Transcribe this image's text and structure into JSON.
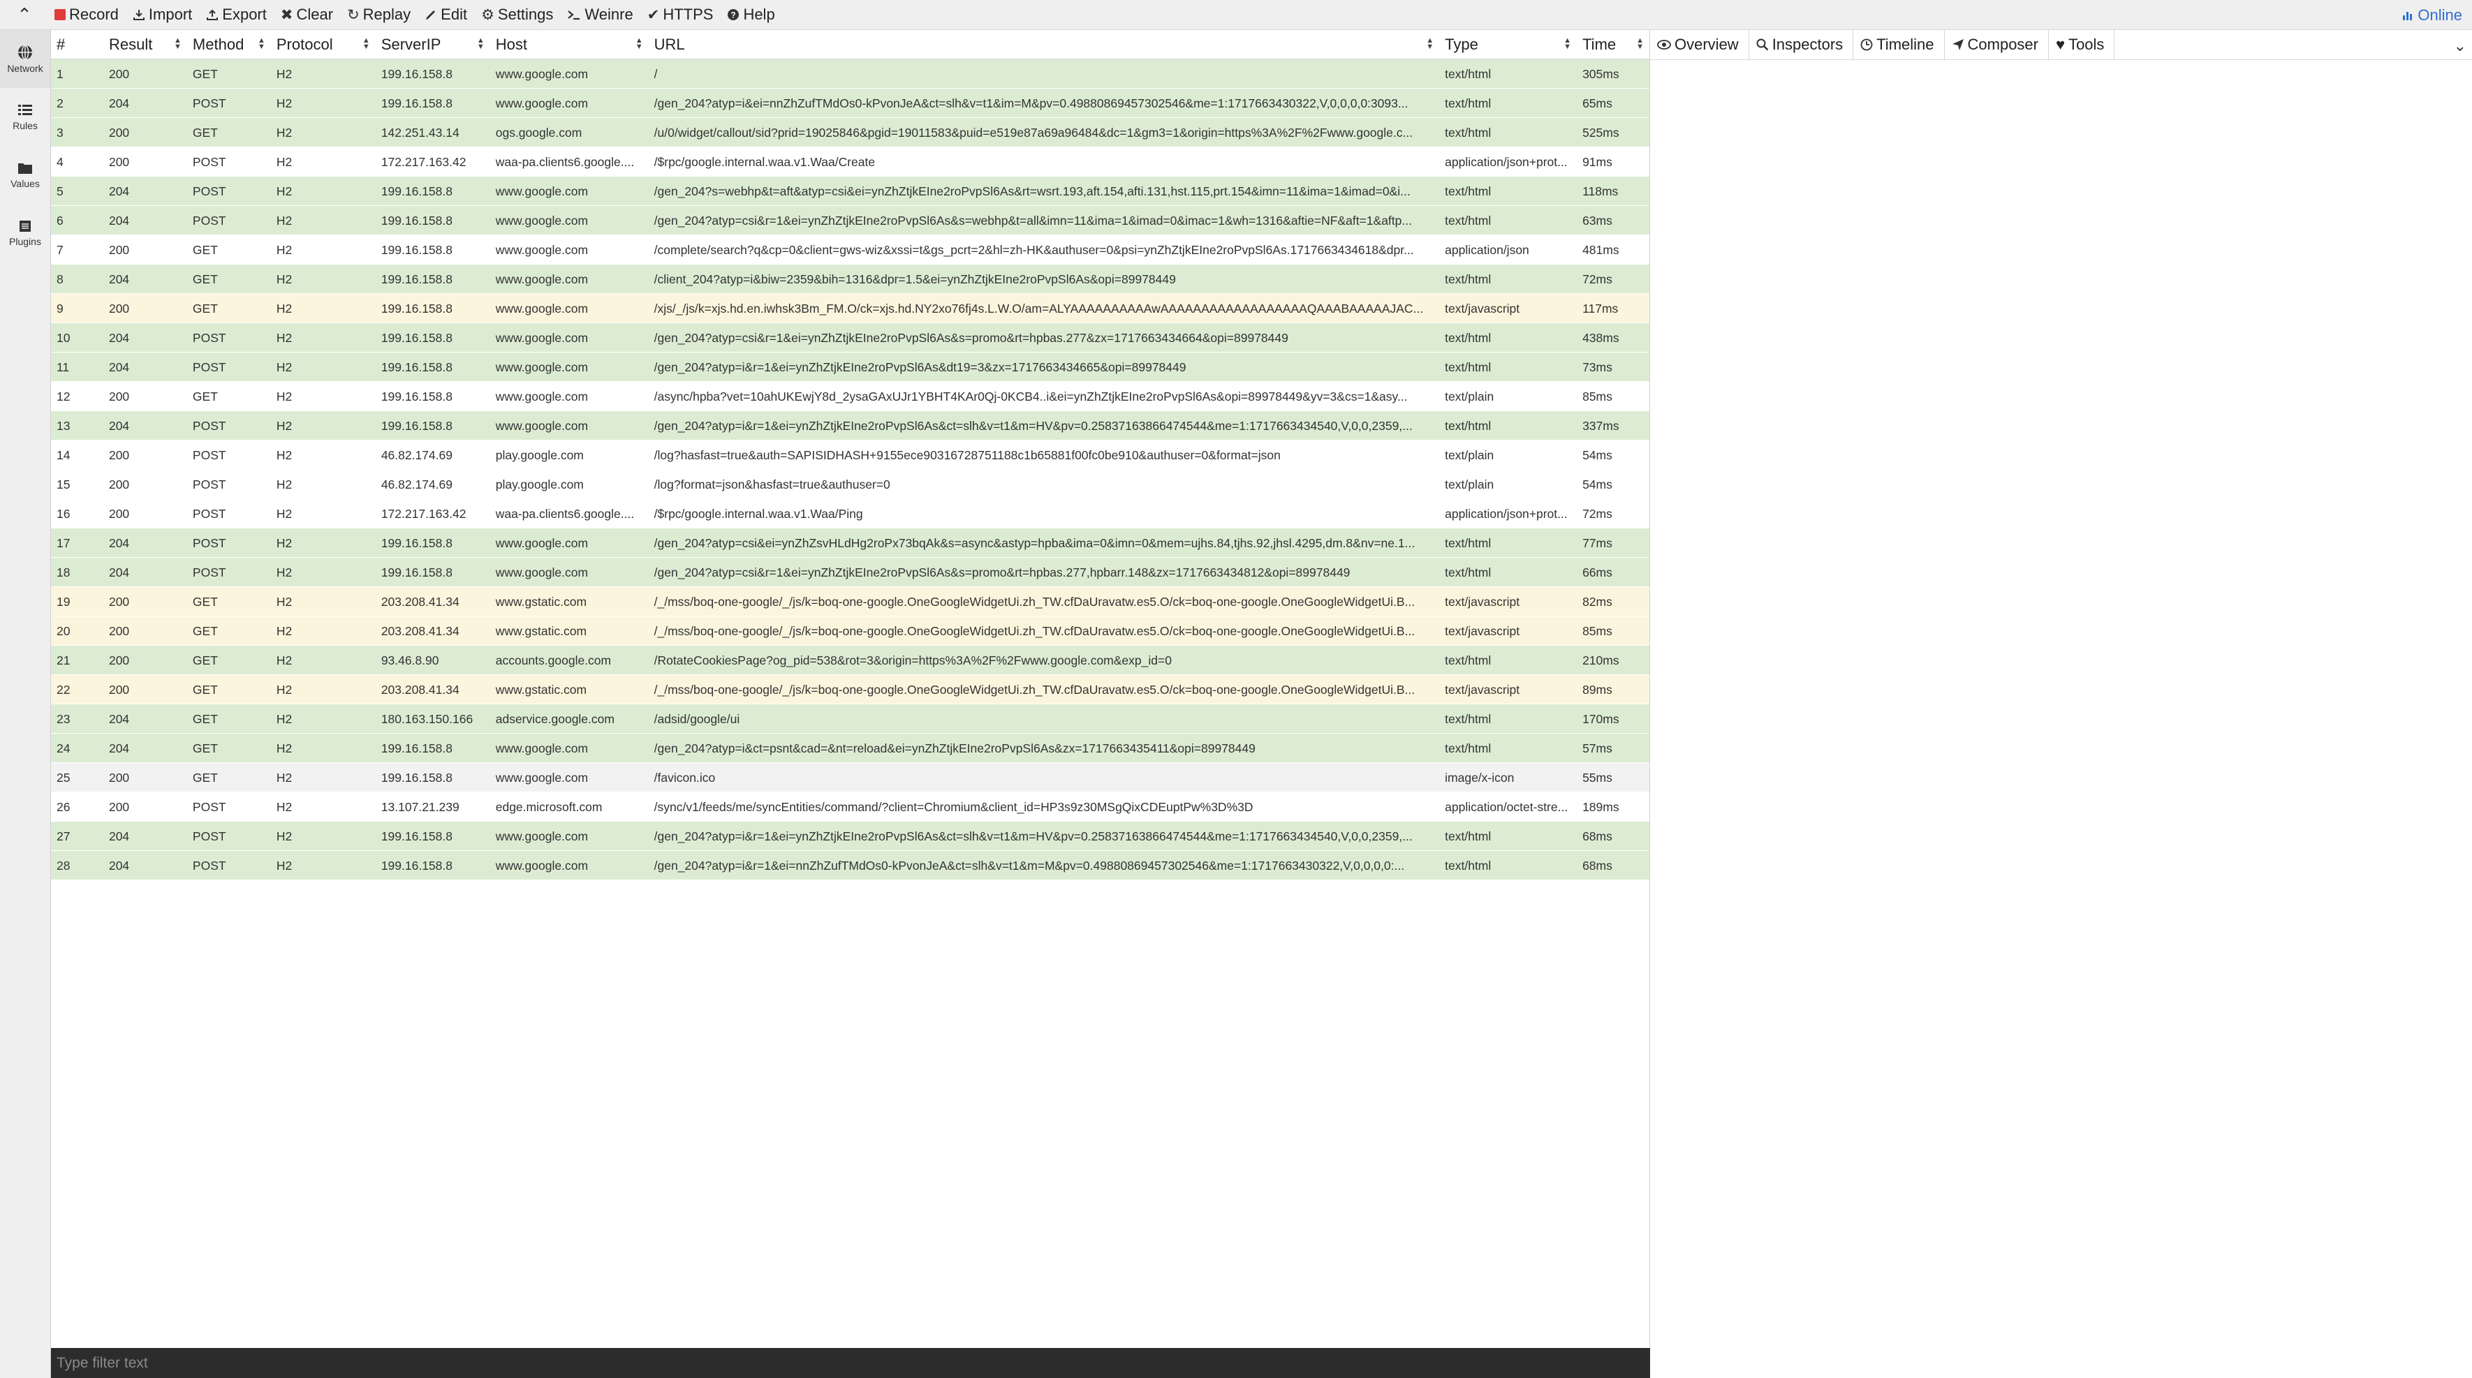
{
  "toolbar": {
    "items": [
      {
        "label": "Record",
        "icon": "record-icon"
      },
      {
        "label": "Import",
        "icon": "import-icon"
      },
      {
        "label": "Export",
        "icon": "export-icon"
      },
      {
        "label": "Clear",
        "icon": "clear-icon"
      },
      {
        "label": "Replay",
        "icon": "replay-icon"
      },
      {
        "label": "Edit",
        "icon": "edit-icon"
      },
      {
        "label": "Settings",
        "icon": "gear-icon"
      },
      {
        "label": "Weinre",
        "icon": "terminal-icon"
      },
      {
        "label": "HTTPS",
        "icon": "check-icon"
      },
      {
        "label": "Help",
        "icon": "help-icon"
      }
    ],
    "status": "Online"
  },
  "sidebar": {
    "items": [
      {
        "label": "Network",
        "icon": "network-icon"
      },
      {
        "label": "Rules",
        "icon": "rules-icon"
      },
      {
        "label": "Values",
        "icon": "folder-icon"
      },
      {
        "label": "Plugins",
        "icon": "plugins-icon"
      }
    ]
  },
  "table": {
    "columns": [
      "#",
      "Result",
      "Method",
      "Protocol",
      "ServerIP",
      "Host",
      "URL",
      "Type",
      "Time"
    ],
    "rows": [
      {
        "n": "1",
        "result": "200",
        "method": "GET",
        "protocol": "H2",
        "ip": "199.16.158.8",
        "host": "www.google.com",
        "url": "/",
        "type": "text/html",
        "time": "305ms",
        "color": "green"
      },
      {
        "n": "2",
        "result": "204",
        "method": "POST",
        "protocol": "H2",
        "ip": "199.16.158.8",
        "host": "www.google.com",
        "url": "/gen_204?atyp=i&ei=nnZhZufTMdOs0-kPvonJeA&ct=slh&v=t1&im=M&pv=0.49880869457302546&me=1:1717663430322,V,0,0,0,0:3093...",
        "type": "text/html",
        "time": "65ms",
        "color": "green"
      },
      {
        "n": "3",
        "result": "200",
        "method": "GET",
        "protocol": "H2",
        "ip": "142.251.43.14",
        "host": "ogs.google.com",
        "url": "/u/0/widget/callout/sid?prid=19025846&pgid=19011583&puid=e519e87a69a96484&dc=1&gm3=1&origin=https%3A%2F%2Fwww.google.c...",
        "type": "text/html",
        "time": "525ms",
        "color": "green"
      },
      {
        "n": "4",
        "result": "200",
        "method": "POST",
        "protocol": "H2",
        "ip": "172.217.163.42",
        "host": "waa-pa.clients6.google....",
        "url": "/$rpc/google.internal.waa.v1.Waa/Create",
        "type": "application/json+prot...",
        "time": "91ms",
        "color": "white"
      },
      {
        "n": "5",
        "result": "204",
        "method": "POST",
        "protocol": "H2",
        "ip": "199.16.158.8",
        "host": "www.google.com",
        "url": "/gen_204?s=webhp&t=aft&atyp=csi&ei=ynZhZtjkEIne2roPvpSl6As&rt=wsrt.193,aft.154,afti.131,hst.115,prt.154&imn=11&ima=1&imad=0&i...",
        "type": "text/html",
        "time": "118ms",
        "color": "green"
      },
      {
        "n": "6",
        "result": "204",
        "method": "POST",
        "protocol": "H2",
        "ip": "199.16.158.8",
        "host": "www.google.com",
        "url": "/gen_204?atyp=csi&r=1&ei=ynZhZtjkEIne2roPvpSl6As&s=webhp&t=all&imn=11&ima=1&imad=0&imac=1&wh=1316&aftie=NF&aft=1&aftp...",
        "type": "text/html",
        "time": "63ms",
        "color": "green"
      },
      {
        "n": "7",
        "result": "200",
        "method": "GET",
        "protocol": "H2",
        "ip": "199.16.158.8",
        "host": "www.google.com",
        "url": "/complete/search?q&cp=0&client=gws-wiz&xssi=t&gs_pcrt=2&hl=zh-HK&authuser=0&psi=ynZhZtjkEIne2roPvpSl6As.1717663434618&dpr...",
        "type": "application/json",
        "time": "481ms",
        "color": "white"
      },
      {
        "n": "8",
        "result": "204",
        "method": "GET",
        "protocol": "H2",
        "ip": "199.16.158.8",
        "host": "www.google.com",
        "url": "/client_204?atyp=i&biw=2359&bih=1316&dpr=1.5&ei=ynZhZtjkEIne2roPvpSl6As&opi=89978449",
        "type": "text/html",
        "time": "72ms",
        "color": "green"
      },
      {
        "n": "9",
        "result": "200",
        "method": "GET",
        "protocol": "H2",
        "ip": "199.16.158.8",
        "host": "www.google.com",
        "url": "/xjs/_/js/k=xjs.hd.en.iwhsk3Bm_FM.O/ck=xjs.hd.NY2xo76fj4s.L.W.O/am=ALYAAAAAAAAAAwAAAAAAAAAAAAAAAAAAQAAABAAAAAJAC...",
        "type": "text/javascript",
        "time": "117ms",
        "color": "yellow"
      },
      {
        "n": "10",
        "result": "204",
        "method": "POST",
        "protocol": "H2",
        "ip": "199.16.158.8",
        "host": "www.google.com",
        "url": "/gen_204?atyp=csi&r=1&ei=ynZhZtjkEIne2roPvpSl6As&s=promo&rt=hpbas.277&zx=1717663434664&opi=89978449",
        "type": "text/html",
        "time": "438ms",
        "color": "green"
      },
      {
        "n": "11",
        "result": "204",
        "method": "POST",
        "protocol": "H2",
        "ip": "199.16.158.8",
        "host": "www.google.com",
        "url": "/gen_204?atyp=i&r=1&ei=ynZhZtjkEIne2roPvpSl6As&dt19=3&zx=1717663434665&opi=89978449",
        "type": "text/html",
        "time": "73ms",
        "color": "green"
      },
      {
        "n": "12",
        "result": "200",
        "method": "GET",
        "protocol": "H2",
        "ip": "199.16.158.8",
        "host": "www.google.com",
        "url": "/async/hpba?vet=10ahUKEwjY8d_2ysaGAxUJr1YBHT4KAr0Qj-0KCB4..i&ei=ynZhZtjkEIne2roPvpSl6As&opi=89978449&yv=3&cs=1&asy...",
        "type": "text/plain",
        "time": "85ms",
        "color": "white"
      },
      {
        "n": "13",
        "result": "204",
        "method": "POST",
        "protocol": "H2",
        "ip": "199.16.158.8",
        "host": "www.google.com",
        "url": "/gen_204?atyp=i&r=1&ei=ynZhZtjkEIne2roPvpSl6As&ct=slh&v=t1&m=HV&pv=0.25837163866474544&me=1:1717663434540,V,0,0,2359,...",
        "type": "text/html",
        "time": "337ms",
        "color": "green"
      },
      {
        "n": "14",
        "result": "200",
        "method": "POST",
        "protocol": "H2",
        "ip": "46.82.174.69",
        "host": "play.google.com",
        "url": "/log?hasfast=true&auth=SAPISIDHASH+9155ece90316728751188c1b65881f00fc0be910&authuser=0&format=json",
        "type": "text/plain",
        "time": "54ms",
        "color": "white"
      },
      {
        "n": "15",
        "result": "200",
        "method": "POST",
        "protocol": "H2",
        "ip": "46.82.174.69",
        "host": "play.google.com",
        "url": "/log?format=json&hasfast=true&authuser=0",
        "type": "text/plain",
        "time": "54ms",
        "color": "white"
      },
      {
        "n": "16",
        "result": "200",
        "method": "POST",
        "protocol": "H2",
        "ip": "172.217.163.42",
        "host": "waa-pa.clients6.google....",
        "url": "/$rpc/google.internal.waa.v1.Waa/Ping",
        "type": "application/json+prot...",
        "time": "72ms",
        "color": "white"
      },
      {
        "n": "17",
        "result": "204",
        "method": "POST",
        "protocol": "H2",
        "ip": "199.16.158.8",
        "host": "www.google.com",
        "url": "/gen_204?atyp=csi&ei=ynZhZsvHLdHg2roPx73bqAk&s=async&astyp=hpba&ima=0&imn=0&mem=ujhs.84,tjhs.92,jhsl.4295,dm.8&nv=ne.1...",
        "type": "text/html",
        "time": "77ms",
        "color": "green"
      },
      {
        "n": "18",
        "result": "204",
        "method": "POST",
        "protocol": "H2",
        "ip": "199.16.158.8",
        "host": "www.google.com",
        "url": "/gen_204?atyp=csi&r=1&ei=ynZhZtjkEIne2roPvpSl6As&s=promo&rt=hpbas.277,hpbarr.148&zx=1717663434812&opi=89978449",
        "type": "text/html",
        "time": "66ms",
        "color": "green"
      },
      {
        "n": "19",
        "result": "200",
        "method": "GET",
        "protocol": "H2",
        "ip": "203.208.41.34",
        "host": "www.gstatic.com",
        "url": "/_/mss/boq-one-google/_/js/k=boq-one-google.OneGoogleWidgetUi.zh_TW.cfDaUravatw.es5.O/ck=boq-one-google.OneGoogleWidgetUi.B...",
        "type": "text/javascript",
        "time": "82ms",
        "color": "yellow"
      },
      {
        "n": "20",
        "result": "200",
        "method": "GET",
        "protocol": "H2",
        "ip": "203.208.41.34",
        "host": "www.gstatic.com",
        "url": "/_/mss/boq-one-google/_/js/k=boq-one-google.OneGoogleWidgetUi.zh_TW.cfDaUravatw.es5.O/ck=boq-one-google.OneGoogleWidgetUi.B...",
        "type": "text/javascript",
        "time": "85ms",
        "color": "yellow"
      },
      {
        "n": "21",
        "result": "200",
        "method": "GET",
        "protocol": "H2",
        "ip": "93.46.8.90",
        "host": "accounts.google.com",
        "url": "/RotateCookiesPage?og_pid=538&rot=3&origin=https%3A%2F%2Fwww.google.com&exp_id=0",
        "type": "text/html",
        "time": "210ms",
        "color": "green"
      },
      {
        "n": "22",
        "result": "200",
        "method": "GET",
        "protocol": "H2",
        "ip": "203.208.41.34",
        "host": "www.gstatic.com",
        "url": "/_/mss/boq-one-google/_/js/k=boq-one-google.OneGoogleWidgetUi.zh_TW.cfDaUravatw.es5.O/ck=boq-one-google.OneGoogleWidgetUi.B...",
        "type": "text/javascript",
        "time": "89ms",
        "color": "yellow"
      },
      {
        "n": "23",
        "result": "204",
        "method": "GET",
        "protocol": "H2",
        "ip": "180.163.150.166",
        "host": "adservice.google.com",
        "url": "/adsid/google/ui",
        "type": "text/html",
        "time": "170ms",
        "color": "green"
      },
      {
        "n": "24",
        "result": "204",
        "method": "GET",
        "protocol": "H2",
        "ip": "199.16.158.8",
        "host": "www.google.com",
        "url": "/gen_204?atyp=i&ct=psnt&cad=&nt=reload&ei=ynZhZtjkEIne2roPvpSl6As&zx=1717663435411&opi=89978449",
        "type": "text/html",
        "time": "57ms",
        "color": "green"
      },
      {
        "n": "25",
        "result": "200",
        "method": "GET",
        "protocol": "H2",
        "ip": "199.16.158.8",
        "host": "www.google.com",
        "url": "/favicon.ico",
        "type": "image/x-icon",
        "time": "55ms",
        "color": "grey"
      },
      {
        "n": "26",
        "result": "200",
        "method": "POST",
        "protocol": "H2",
        "ip": "13.107.21.239",
        "host": "edge.microsoft.com",
        "url": "/sync/v1/feeds/me/syncEntities/command/?client=Chromium&client_id=HP3s9z30MSgQixCDEuptPw%3D%3D",
        "type": "application/octet-stre...",
        "time": "189ms",
        "color": "white"
      },
      {
        "n": "27",
        "result": "204",
        "method": "POST",
        "protocol": "H2",
        "ip": "199.16.158.8",
        "host": "www.google.com",
        "url": "/gen_204?atyp=i&r=1&ei=ynZhZtjkEIne2roPvpSl6As&ct=slh&v=t1&m=HV&pv=0.25837163866474544&me=1:1717663434540,V,0,0,2359,...",
        "type": "text/html",
        "time": "68ms",
        "color": "green"
      },
      {
        "n": "28",
        "result": "204",
        "method": "POST",
        "protocol": "H2",
        "ip": "199.16.158.8",
        "host": "www.google.com",
        "url": "/gen_204?atyp=i&r=1&ei=nnZhZufTMdOs0-kPvonJeA&ct=slh&v=t1&m=M&pv=0.49880869457302546&me=1:1717663430322,V,0,0,0,0:...",
        "type": "text/html",
        "time": "68ms",
        "color": "green"
      }
    ]
  },
  "filter": {
    "placeholder": "Type filter text",
    "value": ""
  },
  "right_panel": {
    "tabs": [
      {
        "label": "Overview",
        "icon": "eye-icon"
      },
      {
        "label": "Inspectors",
        "icon": "search-icon"
      },
      {
        "label": "Timeline",
        "icon": "clock-icon"
      },
      {
        "label": "Composer",
        "icon": "send-icon"
      },
      {
        "label": "Tools",
        "icon": "heart-icon"
      }
    ]
  },
  "colors": {
    "row_green": "#dcecd3",
    "row_yellow": "#fbf5dd",
    "row_white": "#ffffff",
    "row_grey": "#f2f2f2",
    "accent": "#2f6fcf",
    "record": "#e03b3b"
  }
}
